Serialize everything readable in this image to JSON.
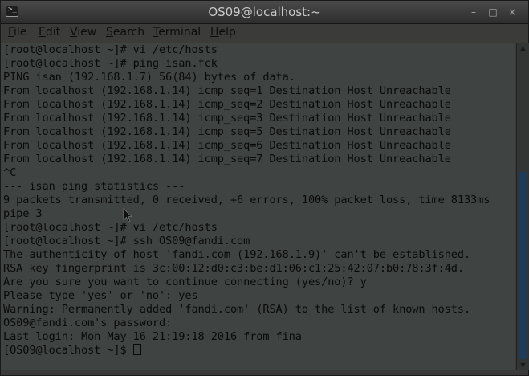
{
  "window": {
    "title": "OS09@localhost:~",
    "controls": {
      "minimize": "–",
      "maximize": "□",
      "close": "×"
    },
    "icon": "terminal-icon"
  },
  "menu": [
    {
      "underline": "F",
      "rest": "ile"
    },
    {
      "underline": "E",
      "rest": "dit"
    },
    {
      "underline": "V",
      "rest": "iew"
    },
    {
      "underline": "S",
      "rest": "earch"
    },
    {
      "underline": "T",
      "rest": "erminal"
    },
    {
      "underline": "H",
      "rest": "elp"
    }
  ],
  "terminal": {
    "lines": [
      "[root@localhost ~]# vi /etc/hosts",
      "[root@localhost ~]# ping isan.fck",
      "PING isan (192.168.1.7) 56(84) bytes of data.",
      "From localhost (192.168.1.14) icmp_seq=1 Destination Host Unreachable",
      "From localhost (192.168.1.14) icmp_seq=2 Destination Host Unreachable",
      "From localhost (192.168.1.14) icmp_seq=3 Destination Host Unreachable",
      "From localhost (192.168.1.14) icmp_seq=5 Destination Host Unreachable",
      "From localhost (192.168.1.14) icmp_seq=6 Destination Host Unreachable",
      "From localhost (192.168.1.14) icmp_seq=7 Destination Host Unreachable",
      "^C",
      "--- isan ping statistics ---",
      "9 packets transmitted, 0 received, +6 errors, 100% packet loss, time 8133ms",
      "pipe 3",
      "[root@localhost ~]# vi /etc/hosts",
      "[root@localhost ~]# ssh OS09@fandi.com",
      "The authenticity of host 'fandi.com (192.168.1.9)' can't be established.",
      "RSA key fingerprint is 3c:00:12:d0:c3:be:d1:06:c1:25:42:07:b0:78:3f:4d.",
      "Are you sure you want to continue connecting (yes/no)? y",
      "Please type 'yes' or 'no': yes",
      "Warning: Permanently added 'fandi.com' (RSA) to the list of known hosts.",
      "OS09@fandi.com's password:",
      "Last login: Mon May 16 21:19:18 2016 from fina"
    ],
    "prompt": "[OS09@localhost ~]$ "
  },
  "colors": {
    "terminal_bg": "#3f4443",
    "text": "#0a0a0a",
    "scroll_thumb": "#1f3b5a"
  }
}
